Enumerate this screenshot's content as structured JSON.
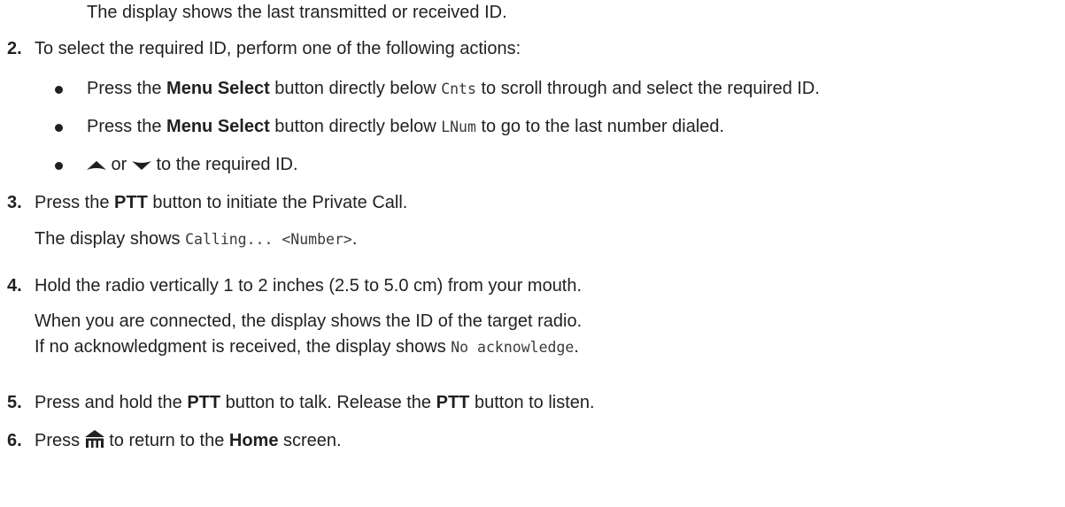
{
  "step1": {
    "result": "The display shows the last transmitted or received ID."
  },
  "step2": {
    "number": "2.",
    "text": "To select the required ID, perform one of the following actions:",
    "bullets": [
      {
        "pre": "Press the ",
        "bold": "Menu Select",
        "mid": " button directly below ",
        "code": "Cnts",
        "post": " to scroll through and select the required ID."
      },
      {
        "pre": "Press the ",
        "bold": "Menu Select",
        "mid": " button directly below ",
        "code": "LNum",
        "post": " to go to the last number dialed."
      },
      {
        "up_icon": "up-arrow-icon",
        "or": " or ",
        "down_icon": "down-arrow-icon",
        "post": " to the required ID."
      }
    ]
  },
  "step3": {
    "number": "3.",
    "pre": "Press the ",
    "bold": "PTT",
    "post": " button to initiate the Private Call.",
    "result_pre": "The display shows ",
    "result_code": "Calling... <Number>",
    "result_post": "."
  },
  "step4": {
    "number": "4.",
    "text": "Hold the radio vertically 1 to 2 inches (2.5 to 5.0 cm) from your mouth.",
    "result1": "When you are connected, the display shows the ID of the target radio.",
    "result2_pre": "If no acknowledgment is received, the display shows ",
    "result2_code": "No acknowledge",
    "result2_post": "."
  },
  "step5": {
    "number": "5.",
    "pre": "Press and hold the ",
    "bold1": "PTT",
    "mid": " button to talk. Release the ",
    "bold2": "PTT",
    "post": " button to listen."
  },
  "step6": {
    "number": "6.",
    "pre": "Press ",
    "icon": "home-icon",
    "mid": " to return to the ",
    "bold": "Home",
    "post": " screen."
  },
  "colors": {
    "text": "#231f20"
  }
}
